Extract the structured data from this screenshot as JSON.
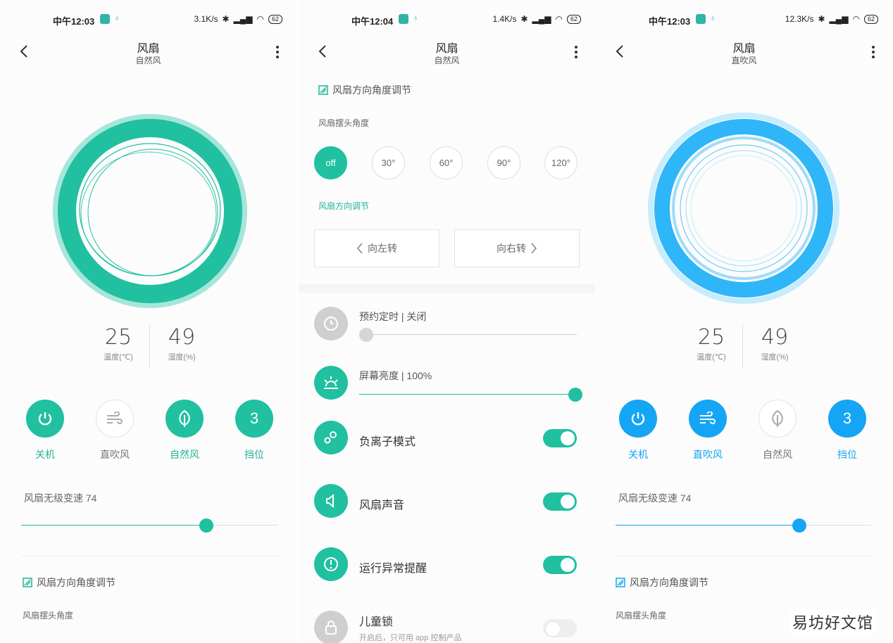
{
  "colors": {
    "teal": "#20c0a0",
    "blue": "#14a5f5",
    "inactive": "#aaaaaa"
  },
  "panel1": {
    "status": {
      "time": "中午12:03",
      "speed": "3.1K/s",
      "battery": "62"
    },
    "nav": {
      "title": "风扇",
      "subtitle": "自然风"
    },
    "temperature": {
      "value": "25",
      "label": "温度(℃)"
    },
    "humidity": {
      "value": "49",
      "label": "湿度(%)"
    },
    "modes": [
      {
        "label": "关机",
        "icon": "power-icon",
        "active": true
      },
      {
        "label": "直吹风",
        "icon": "wind-icon",
        "active": false
      },
      {
        "label": "自然风",
        "icon": "leaf-icon",
        "active": true
      },
      {
        "label": "挡位",
        "icon": "gear-number",
        "value": "3",
        "active": true
      }
    ],
    "speed_label": "风扇无级变速 74",
    "speed_value": 74,
    "direction_header": "风扇方向角度调节",
    "swing_label": "风扇摆头角度"
  },
  "panel2": {
    "status": {
      "time": "中午12:04",
      "speed": "1.4K/s",
      "battery": "62"
    },
    "nav": {
      "title": "风扇",
      "subtitle": "自然风"
    },
    "direction_header": "风扇方向角度调节",
    "swing_label": "风扇摆头角度",
    "angles": [
      "off",
      "30°",
      "60°",
      "90°",
      "120°"
    ],
    "active_angle": "off",
    "direction_label": "风扇方向调节",
    "turn_left": "向左转",
    "turn_right": "向右转",
    "timer": {
      "label": "预约定时 | 关闭",
      "value": 0
    },
    "brightness": {
      "label": "屏幕亮度 | 100%",
      "value": 100
    },
    "settings": [
      {
        "label": "负离子模式",
        "icon": "ion-icon",
        "on": true
      },
      {
        "label": "风扇声音",
        "icon": "speaker-icon",
        "on": true
      },
      {
        "label": "运行异常提醒",
        "icon": "alert-icon",
        "on": true
      }
    ],
    "child_lock": {
      "label": "儿童锁",
      "desc": "开启后，只可用 app 控制产品",
      "on": false
    }
  },
  "panel3": {
    "status": {
      "time": "中午12:03",
      "speed": "12.3K/s",
      "battery": "62"
    },
    "nav": {
      "title": "风扇",
      "subtitle": "直吹风"
    },
    "temperature": {
      "value": "25",
      "label": "温度(℃)"
    },
    "humidity": {
      "value": "49",
      "label": "湿度(%)"
    },
    "modes": [
      {
        "label": "关机",
        "icon": "power-icon",
        "active": true
      },
      {
        "label": "直吹风",
        "icon": "wind-icon",
        "active": true
      },
      {
        "label": "自然风",
        "icon": "leaf-icon",
        "active": false
      },
      {
        "label": "挡位",
        "icon": "gear-number",
        "value": "3",
        "active": true
      }
    ],
    "speed_label": "风扇无级变速 74",
    "speed_value": 74,
    "direction_header": "风扇方向角度调节",
    "swing_label": "风扇摆头角度"
  },
  "watermark": "易坊好文馆"
}
